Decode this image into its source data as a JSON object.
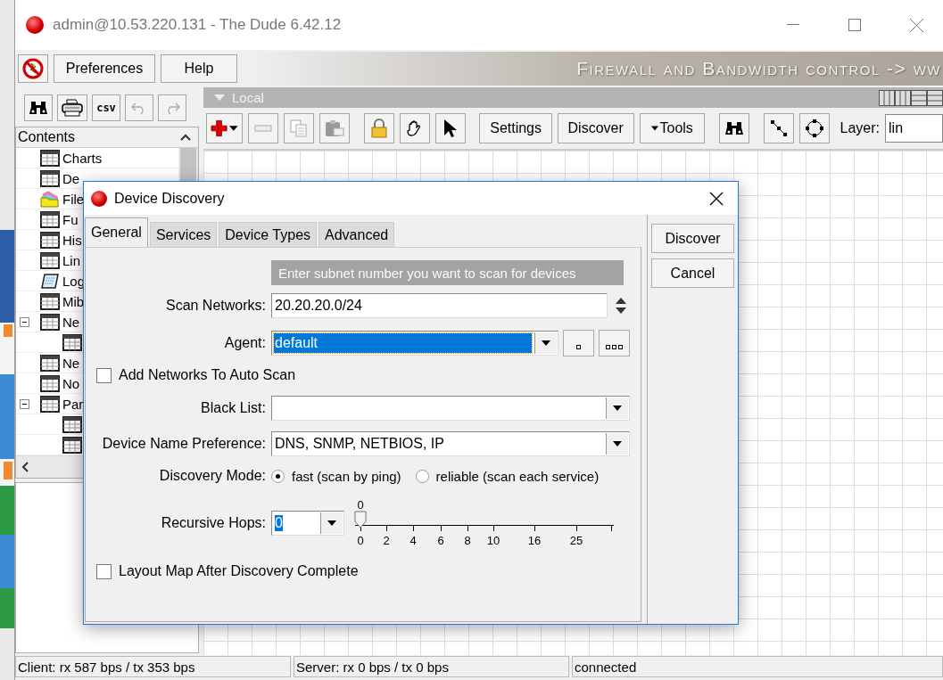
{
  "window": {
    "title": "admin@10.53.220.131 - The Dude 6.42.12"
  },
  "menu": {
    "buttons": [
      "Preferences",
      "Help"
    ],
    "banner": "Firewall and Bandwidth control -> ww"
  },
  "contents": {
    "title": "Contents",
    "toolbar": [
      {
        "kind": "binoculars",
        "disabled": false
      },
      {
        "kind": "printer",
        "disabled": false
      },
      {
        "kind": "text",
        "label": "csv",
        "disabled": false
      },
      {
        "kind": "undo",
        "disabled": true
      },
      {
        "kind": "redo",
        "disabled": true
      }
    ],
    "items": [
      {
        "label": "Charts",
        "kind": "table"
      },
      {
        "label": "De",
        "kind": "table"
      },
      {
        "label": "File",
        "kind": "folder"
      },
      {
        "label": "Fu",
        "kind": "table"
      },
      {
        "label": "His",
        "kind": "table"
      },
      {
        "label": "Lin",
        "kind": "table"
      },
      {
        "label": "Log",
        "kind": "log"
      },
      {
        "label": "Mib",
        "kind": "table"
      },
      {
        "label": "Ne",
        "kind": "table",
        "expanded": true,
        "children": [
          {
            "kind": "table"
          }
        ]
      },
      {
        "label": "Ne",
        "kind": "table"
      },
      {
        "label": "No",
        "kind": "table"
      },
      {
        "label": "Par",
        "kind": "table",
        "expanded": true,
        "children": [
          {
            "kind": "table"
          },
          {
            "kind": "table"
          }
        ]
      }
    ]
  },
  "map": {
    "title": "Local",
    "toolbar": [
      {
        "kind": "add",
        "disabled": false
      },
      {
        "kind": "remove",
        "disabled": true
      },
      {
        "kind": "copy",
        "disabled": true
      },
      {
        "kind": "paste",
        "disabled": true
      },
      {
        "kind": "lock",
        "disabled": false
      },
      {
        "kind": "hand",
        "disabled": false
      },
      {
        "kind": "pointer",
        "disabled": false
      },
      {
        "kind": "text",
        "label": "Settings",
        "disabled": false
      },
      {
        "kind": "text",
        "label": "Discover",
        "disabled": false
      },
      {
        "kind": "menu",
        "label": "Tools",
        "disabled": false
      },
      {
        "kind": "binoculars",
        "disabled": false
      },
      {
        "kind": "link",
        "disabled": false
      },
      {
        "kind": "ring",
        "disabled": false
      }
    ],
    "layer_label": "Layer:",
    "layer_value": "lin"
  },
  "dialog": {
    "title": "Device Discovery",
    "tabs": [
      {
        "label": "General",
        "selected": true
      },
      {
        "label": "Services",
        "selected": false
      },
      {
        "label": "Device Types",
        "selected": false
      },
      {
        "label": "Advanced",
        "selected": false
      }
    ],
    "buttons": [
      "Discover",
      "Cancel"
    ],
    "hint": "Enter subnet number you want to scan for devices",
    "fields": [
      {
        "kind": "spin",
        "label": "Scan Networks:",
        "value": "20.20.20.0/24",
        "highlighted": false
      },
      {
        "kind": "agent",
        "label": "Agent:",
        "value": "default",
        "highlighted": true
      },
      {
        "kind": "checkbox",
        "label": "Add Networks To Auto Scan",
        "checked": false
      },
      {
        "kind": "combo",
        "label": "Black List:"
      },
      {
        "kind": "combo",
        "label": "Device Name Preference:",
        "value": "DNS, SNMP, NETBIOS, IP",
        "highlighted": false
      },
      {
        "kind": "radio",
        "label": "Discovery Mode:",
        "options": [
          {
            "label": "fast (scan by ping)",
            "selected": true
          },
          {
            "label": "reliable (scan each service)",
            "selected": false
          }
        ]
      },
      {
        "kind": "hops",
        "label": "Recursive Hops:",
        "value": "0",
        "highlighted": true,
        "reading": "0",
        "level": 0,
        "ticks": [
          "0",
          "2",
          "4",
          "6",
          "8",
          "10",
          "16",
          "25"
        ]
      },
      {
        "kind": "checkbox",
        "label": "Layout Map After Discovery Complete",
        "checked": false
      }
    ]
  },
  "status_bar": [
    "Client: rx 587 bps / tx 353 bps",
    "Server: rx 0 bps / tx 0 bps",
    "connected"
  ]
}
